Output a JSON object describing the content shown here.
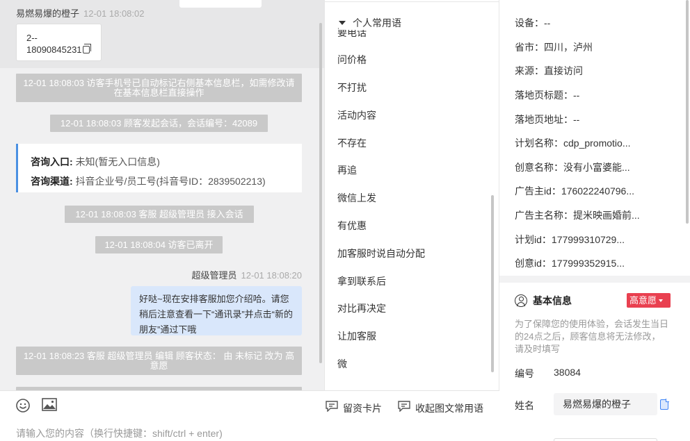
{
  "chat": {
    "sender_name": "易燃易爆的橙子",
    "sender_time": "12-01 18:08:02",
    "phone_card": {
      "line1": "2--",
      "line2": "18090845231"
    },
    "system_messages": [
      "12-01 18:08:03 访客手机号已自动标记右侧基本信息栏，如需修改请在基本信息栏直接操作",
      "12-01 18:08:03 顾客发起会话，会话编号：42089",
      "12-01 18:08:03 客服 超级管理员 接入会话",
      "12-01 18:08:04 访客已离开",
      "12-01 18:08:23 客服 超级管理员 编辑 顾客状态： 由 未标记 改为 高意愿"
    ],
    "entry_card": {
      "entry_label": "咨询入口:",
      "entry_value": "未知(暂无入口信息)",
      "channel_label": "咨询渠道:",
      "channel_value": "抖音企业号/员工号(抖音号ID：2839502213)"
    },
    "agent_name": "超级管理员",
    "agent_time": "12-01 18:08:20",
    "agent_message": "好哒~现在安排客服加您介绍哈。请您稍后注意查看一下“通讯录”并点击“新的朋友”通过下哦"
  },
  "toolbar": {
    "emoji_icon": "emoji-icon",
    "image_icon": "image-icon",
    "card_label": "留资卡片",
    "collapse_label": "收起图文常用语",
    "input_placeholder": "请输入您的内容（换行快捷键：shift/ctrl + enter)"
  },
  "phrases": {
    "header": "个人常用语",
    "partial_item": "要电话",
    "items": [
      "问价格",
      "不打扰",
      "活动内容",
      "不存在",
      "再追",
      "微信上发",
      "有优惠",
      "加客服时说自动分配",
      "拿到联系后",
      "对比再决定",
      "让加客服",
      "微"
    ]
  },
  "info": {
    "rows": [
      {
        "key": "设备：",
        "value": "--"
      },
      {
        "key": "省市：",
        "value": "四川，泸州"
      },
      {
        "key": "来源：",
        "value": "直接访问"
      },
      {
        "key": "落地页标题：",
        "value": "--"
      },
      {
        "key": "落地页地址：",
        "value": "--"
      },
      {
        "key": "计划名称：",
        "value": "cdp_promotio..."
      },
      {
        "key": "创意名称：",
        "value": "没有小富婆能..."
      },
      {
        "key": "广告主id：",
        "value": "176022240796..."
      },
      {
        "key": "广告主名称：",
        "value": "提米映画婚前..."
      },
      {
        "key": "计划id：",
        "value": "177999310729..."
      },
      {
        "key": "创意id：",
        "value": "177999352915..."
      }
    ],
    "basic_title": "基本信息",
    "intent_badge": "高意愿",
    "notice": "为了保障您的使用体验，会话发生当日的24点之后，顾客信息将无法修改，请及时填写",
    "number_label": "编号",
    "number_value": "38084",
    "name_label": "姓名",
    "name_value": "易燃易爆的橙子"
  }
}
